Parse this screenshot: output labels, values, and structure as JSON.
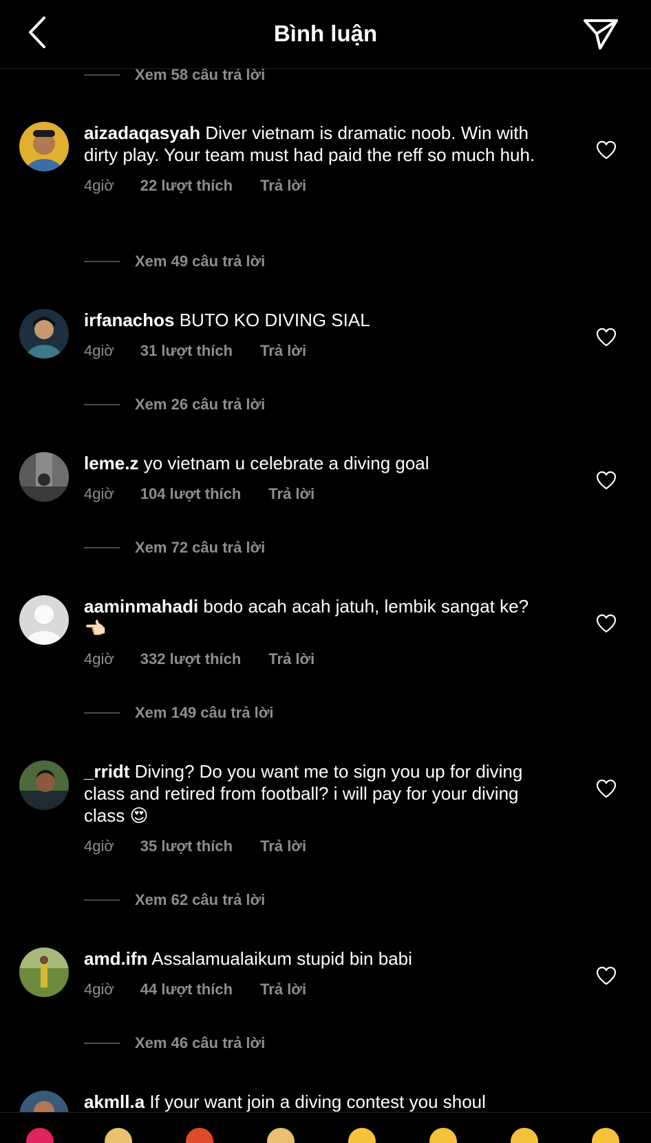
{
  "header": {
    "title": "Bình luận"
  },
  "top_replies": {
    "label": "Xem 58 câu trả lời"
  },
  "comments": [
    {
      "username": "aizadaqasyah",
      "text": "Diver vietnam is dramatic noob. Win with dirty play. Your team must had paid the reff so much huh.",
      "time": "4giờ",
      "likes": "22 lượt thích",
      "reply": "Trả lời",
      "view_replies": "Xem 49 câu trả lời"
    },
    {
      "username": "irfanachos",
      "text": "BUTO KO DIVING SIAL",
      "time": "4giờ",
      "likes": "31 lượt thích",
      "reply": "Trả lời",
      "view_replies": "Xem 26 câu trả lời"
    },
    {
      "username": "leme.z",
      "text": "yo vietnam u celebrate a diving goal",
      "time": "4giờ",
      "likes": "104 lượt thích",
      "reply": "Trả lời",
      "view_replies": "Xem 72 câu trả lời"
    },
    {
      "username": "aaminmahadi",
      "text": "bodo acah acah jatuh, lembik sangat ke? 👈🏻",
      "time": "4giờ",
      "likes": "332 lượt thích",
      "reply": "Trả lời",
      "view_replies": "Xem 149 câu trả lời"
    },
    {
      "username": "_rridt",
      "text": "Diving? Do you want me to sign you up for diving class and retired from football? i will pay for your diving class 😍",
      "time": "4giờ",
      "likes": "35 lượt thích",
      "reply": "Trả lời",
      "view_replies": "Xem 62 câu trả lời"
    },
    {
      "username": "amd.ifn",
      "text": "Assalamualaikum stupid bin babi",
      "time": "4giờ",
      "likes": "44 lượt thích",
      "reply": "Trả lời",
      "view_replies": "Xem 46 câu trả lời"
    },
    {
      "username": "akmll.a",
      "text": "If your want join a diving contest you shoul"
    }
  ],
  "icons": {
    "back": "chevron-left-icon",
    "share": "paper-plane-icon",
    "like": "heart-icon"
  },
  "colors": {
    "background": "#000000",
    "text": "#ffffff",
    "secondary_text": "#8e8e8e"
  }
}
